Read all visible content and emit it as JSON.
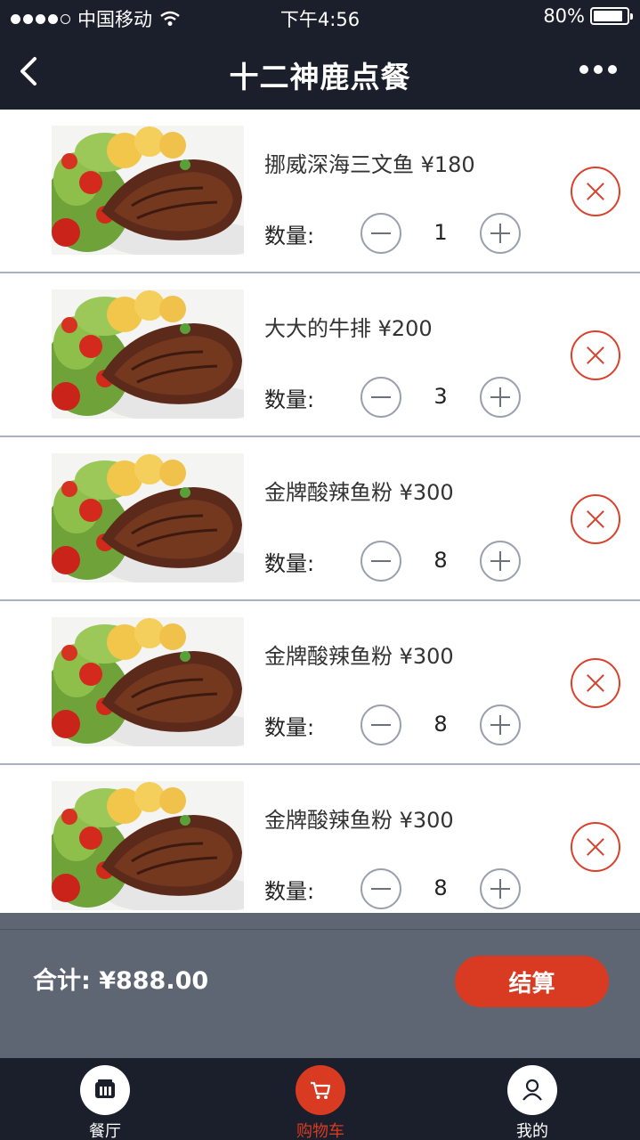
{
  "status_bar": {
    "carrier": "中国移动",
    "time": "下午4:56",
    "battery": "80%",
    "battery_level": 0.8
  },
  "nav": {
    "title": "十二神鹿点餐",
    "back_icon": "chevron-left-icon",
    "more_icon": "more-dots-icon"
  },
  "cart": {
    "quantity_label": "数量:",
    "items": [
      {
        "name": "挪威深海三文鱼 ¥180",
        "quantity": "1"
      },
      {
        "name": "大大的牛排 ¥200",
        "quantity": "3"
      },
      {
        "name": "金牌酸辣鱼粉 ¥300",
        "quantity": "8"
      },
      {
        "name": "金牌酸辣鱼粉 ¥300",
        "quantity": "8"
      },
      {
        "name": "金牌酸辣鱼粉 ¥300",
        "quantity": "8"
      }
    ]
  },
  "summary": {
    "total": "合计: ¥888.00",
    "checkout_label": "结算"
  },
  "tabbar": {
    "tabs": [
      {
        "label": "餐厅",
        "icon": "restaurant-icon"
      },
      {
        "label": "购物车",
        "icon": "cart-icon",
        "active": true
      },
      {
        "label": "我的",
        "icon": "user-icon"
      }
    ]
  },
  "colors": {
    "accent": "#d93a22",
    "nav_bg": "#1b1f2c",
    "total_bg": "#5f6673"
  }
}
